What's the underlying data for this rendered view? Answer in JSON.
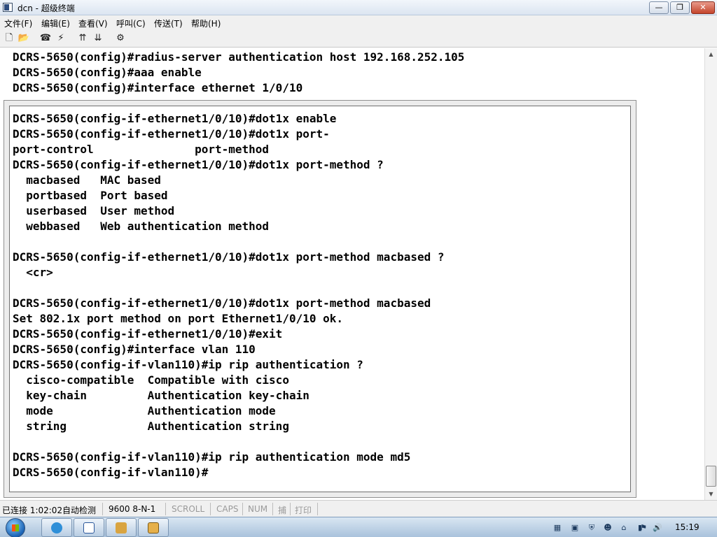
{
  "window": {
    "title": "dcn - 超级终端",
    "buttons": {
      "minimize": "—",
      "maximize": "❐",
      "close": "✕"
    }
  },
  "menu": [
    "文件(F)",
    "编辑(E)",
    "查看(V)",
    "呼叫(C)",
    "传送(T)",
    "帮助(H)"
  ],
  "toolbar": {
    "icons": [
      "new-file-icon",
      "open-folder-icon",
      "call-icon",
      "disconnect-icon",
      "send-icon",
      "receive-icon",
      "properties-icon"
    ],
    "glyphs": [
      "🗋",
      "📂",
      "☎",
      "⚡",
      "⇈",
      "⇊",
      "⚙"
    ]
  },
  "terminal": {
    "background_lines": [
      "DCRS-5650(config)#radius-server authentication host 192.168.252.105",
      "DCRS-5650(config)#aaa enable",
      "DCRS-5650(config)#interface ethernet 1/0/10"
    ],
    "dialog_lines": [
      "DCRS-5650(config-if-ethernet1/0/10)#dot1x enable",
      "DCRS-5650(config-if-ethernet1/0/10)#dot1x port-",
      "port-control               port-method",
      "DCRS-5650(config-if-ethernet1/0/10)#dot1x port-method ?",
      "  macbased   MAC based",
      "  portbased  Port based",
      "  userbased  User method",
      "  webbased   Web authentication method",
      "",
      "DCRS-5650(config-if-ethernet1/0/10)#dot1x port-method macbased ?",
      "  <cr>",
      "",
      "DCRS-5650(config-if-ethernet1/0/10)#dot1x port-method macbased",
      "Set 802.1x port method on port Ethernet1/0/10 ok.",
      "DCRS-5650(config-if-ethernet1/0/10)#exit",
      "DCRS-5650(config)#interface vlan 110",
      "DCRS-5650(config-if-vlan110)#ip rip authentication ?",
      "  cisco-compatible  Compatible with cisco",
      "  key-chain         Authentication key-chain",
      "  mode              Authentication mode",
      "  string            Authentication string",
      "",
      "DCRS-5650(config-if-vlan110)#ip rip authentication mode md5",
      "DCRS-5650(config-if-vlan110)#"
    ]
  },
  "scrollbar": {
    "up": "▲",
    "down": "▼"
  },
  "status": {
    "connection": "已连接 1:02:02",
    "detect": "自动检测",
    "port_settings": "9600 8-N-1",
    "scroll": "SCROLL",
    "caps": "CAPS",
    "num": "NUM",
    "capture": "捕",
    "print": "打印"
  },
  "taskbar": {
    "apps": [
      "ie-icon",
      "word-icon",
      "box-icon",
      "hyperterminal-icon"
    ],
    "tray": [
      "keyboard-icon",
      "network-icon",
      "shield-icon",
      "users-icon",
      "device-icon",
      "battery-icon",
      "flag-icon",
      "volume-icon"
    ],
    "tray_glyphs": [
      "▦",
      "▣",
      "⛨",
      "☻",
      "⌂",
      "▮",
      "⚑",
      "🔊"
    ],
    "clock": "15:19"
  },
  "colors": {
    "terminal_bg": "#ffffff",
    "text": "#000000",
    "dim_status": "#9a9a9a",
    "taskbar": "#a9c2dc"
  }
}
